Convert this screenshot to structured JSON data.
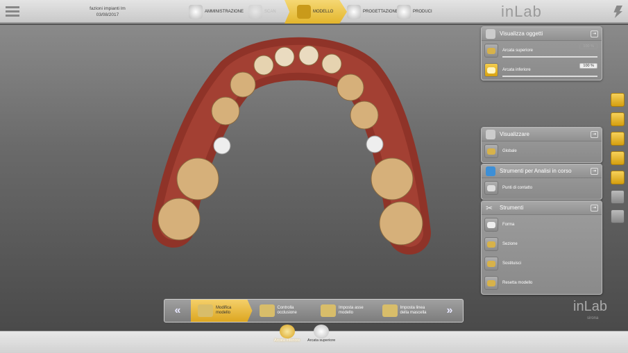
{
  "header": {
    "case_name": "fazioni impianti lm",
    "date": "03/08/2017",
    "logo": "inLab",
    "steps": [
      {
        "label": "AMMINISTRAZIONE"
      },
      {
        "label": "SCAN"
      },
      {
        "label": "MODELLO"
      },
      {
        "label": "PROGETTAZIONE"
      },
      {
        "label": "PRODUCI"
      }
    ]
  },
  "panels": {
    "visualizza_oggetti": {
      "title": "Visualizza oggetti",
      "items": [
        {
          "label": "Arcata superiore",
          "value": "100 %"
        },
        {
          "label": "Arcata inferiore",
          "value": "100 %"
        }
      ]
    },
    "visualizzare": {
      "title": "Visualizzare",
      "items": [
        {
          "label": "Globale"
        }
      ]
    },
    "analisi": {
      "title": "Strumenti per Analisi in corso",
      "items": [
        {
          "label": "Punti di contatto"
        }
      ]
    },
    "strumenti": {
      "title": "Strumenti",
      "items": [
        {
          "label": "Forma"
        },
        {
          "label": "Sezione"
        },
        {
          "label": "Sostituisci"
        },
        {
          "label": "Resetta modello"
        }
      ]
    }
  },
  "wizard": {
    "steps": [
      {
        "l1": "Modifica",
        "l2": "modello"
      },
      {
        "l1": "Controlla",
        "l2": "occlusione"
      },
      {
        "l1": "Imposta asse",
        "l2": "modello"
      },
      {
        "l1": "Imposta linea",
        "l2": "della mascella"
      }
    ]
  },
  "watermark": {
    "logo": "inLab",
    "brand": "sirona"
  },
  "bottom": {
    "items": [
      {
        "label": "Arcata inferiore"
      },
      {
        "label": "Arcata superiore"
      }
    ]
  },
  "colors": {
    "accent": "#e3b52c",
    "gum": "#9c3b30",
    "tooth": "#d9b784"
  }
}
